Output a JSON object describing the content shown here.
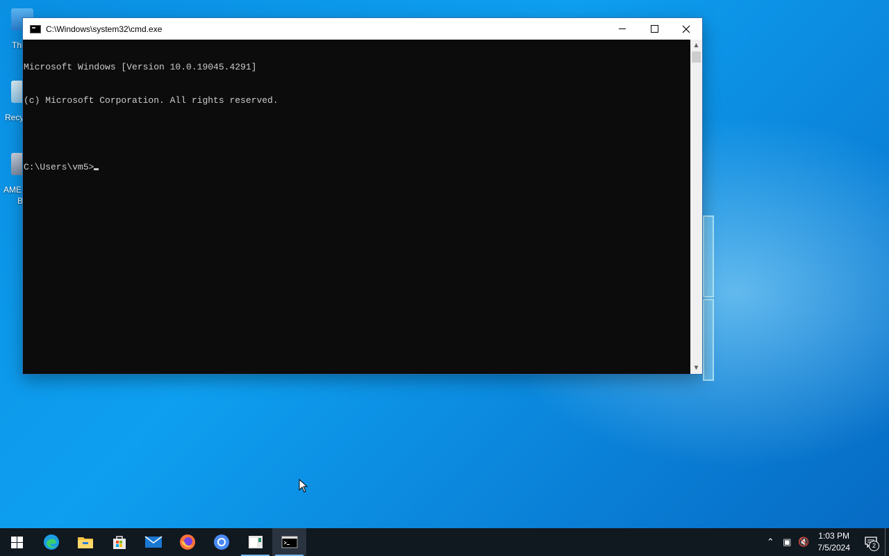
{
  "desktop": {
    "icons": [
      {
        "label": "Thi"
      },
      {
        "label": "Recy"
      },
      {
        "label_line1": "AME",
        "label_line2": "B"
      }
    ]
  },
  "window": {
    "title": "C:\\Windows\\system32\\cmd.exe",
    "console": {
      "lines": [
        "Microsoft Windows [Version 10.0.19045.4291]",
        "(c) Microsoft Corporation. All rights reserved.",
        "",
        "C:\\Users\\vm5>"
      ]
    }
  },
  "taskbar": {
    "apps": [
      "start",
      "edge",
      "file-explorer",
      "microsoft-store",
      "mail",
      "firefox",
      "chrome",
      "app",
      "cmd"
    ],
    "clock": {
      "time": "1:03 PM",
      "date": "7/5/2024"
    },
    "notifications_count": "2"
  },
  "colors": {
    "console_bg": "#0c0c0c",
    "console_fg": "#cccccc",
    "taskbar_bg": "#101820",
    "accent": "#76b9ed"
  }
}
